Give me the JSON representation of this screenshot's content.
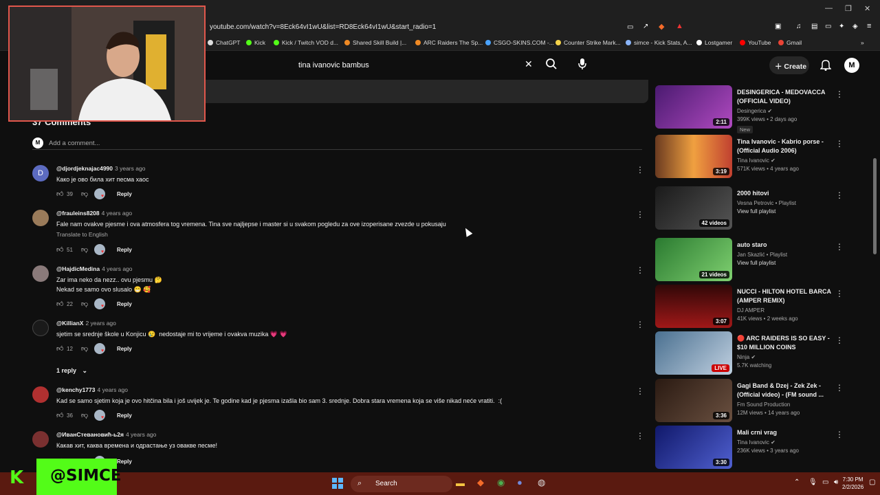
{
  "browser": {
    "url": "youtube.com/watch?v=8Eck64vI1wU&list=RD8Eck64vI1wU&start_radio=1",
    "bookmarks": [
      {
        "label": "ChatGPT",
        "color": "#dddddd"
      },
      {
        "label": "Kick",
        "color": "#53fc18"
      },
      {
        "label": "Kick / Twitch VOD d...",
        "color": "#53fc18"
      },
      {
        "label": "Shared Skill Build |...",
        "color": "#f08a24"
      },
      {
        "label": "ARC Raiders The Sp...",
        "color": "#f08a24"
      },
      {
        "label": "CSGO-SKINS.COM -...",
        "color": "#4aa3ff"
      },
      {
        "label": "Counter Strike Mark...",
        "color": "#f5d34a"
      },
      {
        "label": "simce - Kick Stats, A...",
        "color": "#8ab4f8"
      },
      {
        "label": "Lostgamer",
        "color": "#ffffff"
      },
      {
        "label": "YouTube",
        "color": "#ff0000"
      },
      {
        "label": "Gmail",
        "color": "#ea4335"
      }
    ]
  },
  "header": {
    "search_value": "tina ivanovic bambus",
    "create_label": "Create",
    "avatar_letter": "M"
  },
  "comments": {
    "title": "37 Comments",
    "add_placeholder": "Add a comment...",
    "reply_label": "Reply",
    "translate_label": "Translate to English",
    "replies_toggle": "1 reply",
    "items": [
      {
        "user": "@djordjeknajac4990",
        "time": "3 years ago",
        "text": "Како је ово била хит песма хаос",
        "likes": "39",
        "avatar_color": "#5c6bc0",
        "avatar_letter": "D"
      },
      {
        "user": "@frauleins8208",
        "time": "4 years ago",
        "text": "Fale nam ovakve pjesme i ova atmosfera tog vremena. Tina sve najljepse i master si u svakom pogledu za ove izoperisane zvezde u pokusaju",
        "likes": "51",
        "avatar_color": "#9a7b5a",
        "avatar_letter": ""
      },
      {
        "user": "@HajdicMedina",
        "time": "4 years ago",
        "text": "Zar ima neko da nezz.. ovu pjesmu 🤔\nNekad se samo ovo slusalo 😁 🥰",
        "likes": "22",
        "avatar_color": "#8a7a7a",
        "avatar_letter": ""
      },
      {
        "user": "@KillianX",
        "time": "2 years ago",
        "text": "sjetim se srednje škole u Konjicu 😢  nedostaje mi to vrijeme i ovakva muzika 💗 💗",
        "likes": "12",
        "avatar_color": "#1a1a1a",
        "avatar_letter": ""
      },
      {
        "user": "@kenchy1773",
        "time": "4 years ago",
        "text": "Kad se samo sjetim koja je ovo hitčina bila i još uvijek je. Te godine kad je pjesma izašla bio sam 3. srednje. Dobra stara vremena koja se više nikad neće vratiti.  :(",
        "likes": "36",
        "avatar_color": "#b03030",
        "avatar_letter": ""
      },
      {
        "user": "@ИванСтевановић-ь2я",
        "time": "4 years ago",
        "text": "Какав хит, каква времена и одрастање уз овакве песме!",
        "likes": "",
        "avatar_color": "#7a3030",
        "avatar_letter": ""
      }
    ]
  },
  "sidebar": {
    "items": [
      {
        "title": "DESINGERICA - MEDOVACCA (OFFICIAL VIDEO)",
        "channel": "Desingerica",
        "verified": true,
        "meta": "399K views • 2 days ago",
        "badge": "New",
        "duration": "2:11",
        "thumb": "#7a2fa0"
      },
      {
        "title": "Tina Ivanovic - Kabrio porse - (Official Audio 2006)",
        "channel": "Tina Ivanovic",
        "verified": true,
        "meta": "571K views • 4 years ago",
        "badge": "",
        "duration": "3:19",
        "thumb": "#d0842c"
      },
      {
        "title": "2000 hitovi",
        "channel": "Vesna Petrovic • Playlist",
        "verified": false,
        "meta": "View full playlist",
        "badge": "",
        "duration": "42 videos",
        "thumb": "#303030"
      },
      {
        "title": "auto staro",
        "channel": "Jan Skazlić • Playlist",
        "verified": false,
        "meta": "View full playlist",
        "badge": "",
        "duration": "21 videos",
        "thumb": "#3f8f3a"
      },
      {
        "title": "NUCCI - HILTON HOTEL BARCA (AMPER REMIX)",
        "channel": "DJ AMPER",
        "verified": false,
        "meta": "41K views • 2 weeks ago",
        "badge": "",
        "duration": "3:07",
        "thumb": "#8a1a1a"
      },
      {
        "title": "🔴 ARC RAIDERS IS SO EASY - $10 MILLION COINS",
        "channel": "Ninja",
        "verified": true,
        "meta": "5.7K watching",
        "badge": "",
        "duration": "LIVE",
        "thumb": "#6a8fb0"
      },
      {
        "title": "Gagi Band & Dzej - Zek Zek - (Official video) - (FM sound ...",
        "channel": "Fm Sound Production",
        "verified": false,
        "meta": "12M views • 14 years ago",
        "badge": "",
        "duration": "3:36",
        "thumb": "#4a3a30"
      },
      {
        "title": "Mali crni vrag",
        "channel": "Tina Ivanovic",
        "verified": true,
        "meta": "236K views • 3 years ago",
        "badge": "",
        "duration": "3:30",
        "thumb": "#2a3a8a"
      }
    ]
  },
  "taskbar": {
    "search_label": "Search",
    "time": "7:30 PM",
    "date": "2/2/2026"
  },
  "overlay": {
    "kick_handle": "@SIMCE"
  }
}
